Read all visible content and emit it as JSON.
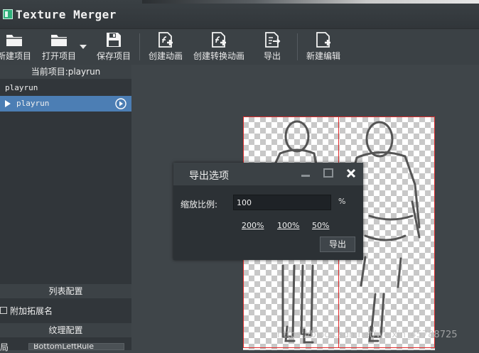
{
  "window": {
    "title": "Texture Merger"
  },
  "toolbar": {
    "new_project": "新建项目",
    "open_project": "打开项目",
    "save_project": "保存项目",
    "create_animation": "创建动画",
    "create_transform_animation": "创建转换动画",
    "export": "导出",
    "new_edit": "新建编辑"
  },
  "left_panel": {
    "current_project_header": "当前项目:playrun",
    "tree": [
      {
        "label": "playrun"
      },
      {
        "label": "playrun"
      }
    ],
    "list_config_header": "列表配置",
    "append_extension_label": "附加拓展名",
    "texture_config_header": "纹理配置",
    "layout_label": "布局",
    "layout_value": "BottomLeftRule"
  },
  "dialog": {
    "title": "导出选项",
    "scale_label": "缩放比例:",
    "scale_value": "100",
    "percent_sign": "%",
    "presets": [
      "200%",
      "100%",
      "50%"
    ],
    "export_button": "导出"
  },
  "watermark": "https://blog.csdn.net/weixin_45788725",
  "colors": {
    "selection": "#4c7eb4",
    "frame_border": "#e02b2b",
    "app_icon": "#2fb07a"
  }
}
